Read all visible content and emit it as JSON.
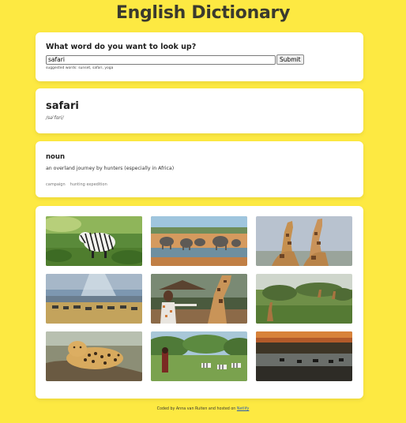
{
  "header": {
    "title": "English Dictionary"
  },
  "search": {
    "question": "What word do you want to look up?",
    "value": "safari",
    "submit_label": "Submit",
    "suggestions": "suggested words: sunset, safari, yoga"
  },
  "result": {
    "word": "safari",
    "phonetic": "/səˈfɑri/"
  },
  "meaning": {
    "part_of_speech": "noun",
    "definition": "an overland journey by hunters (especially in Africa)",
    "synonyms": [
      "campaign",
      "hunting expedition"
    ]
  },
  "photos": [
    {
      "subject": "zebras in green grass"
    },
    {
      "subject": "elephants at a waterhole"
    },
    {
      "subject": "giraffes close-up"
    },
    {
      "subject": "zebra herd under sunbeams"
    },
    {
      "subject": "person feeding a giraffe"
    },
    {
      "subject": "giraffes in savanna"
    },
    {
      "subject": "leopard resting on a branch"
    },
    {
      "subject": "zebras and a walker in grassland"
    },
    {
      "subject": "animals at dusk by water"
    }
  ],
  "footer": {
    "text": "Coded by Anna van Ruiten and hosted on",
    "link_label": "Netlify"
  },
  "colors": {
    "background": "#fde942",
    "card": "#ffffff",
    "link": "#2a5db0"
  }
}
